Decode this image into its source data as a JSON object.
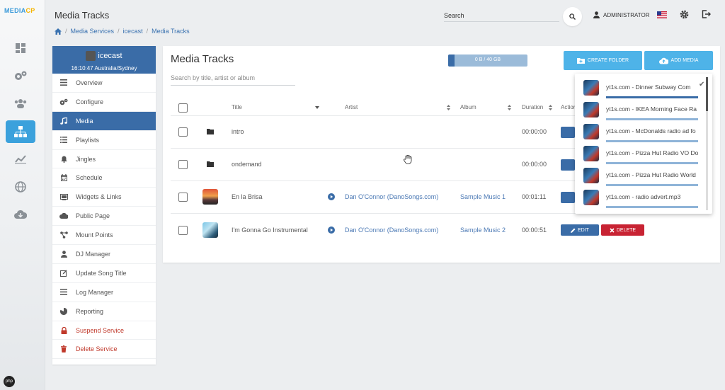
{
  "app": {
    "logo_text": "MEDIA",
    "logo_suffix": "CP",
    "php_badge": "php"
  },
  "header": {
    "title": "Media Tracks",
    "search_placeholder": "Search",
    "user_label": "ADMINISTRATOR",
    "breadcrumb": [
      "Media Services",
      "icecast",
      "Media Tracks"
    ]
  },
  "service": {
    "name": "icecast",
    "clock": "16:10:47 Australia/Sydney",
    "nav": [
      {
        "label": "Overview",
        "icon": "list-icon"
      },
      {
        "label": "Configure",
        "icon": "gears-icon"
      },
      {
        "label": "Media",
        "icon": "music-icon",
        "active": true
      },
      {
        "label": "Playlists",
        "icon": "playlist-icon"
      },
      {
        "label": "Jingles",
        "icon": "bell-icon"
      },
      {
        "label": "Schedule",
        "icon": "calendar-icon"
      },
      {
        "label": "Widgets & Links",
        "icon": "widget-icon"
      },
      {
        "label": "Public Page",
        "icon": "cloud-icon"
      },
      {
        "label": "Mount Points",
        "icon": "network-icon"
      },
      {
        "label": "DJ Manager",
        "icon": "user-icon"
      },
      {
        "label": "Update Song Title",
        "icon": "edit-icon"
      },
      {
        "label": "Log Manager",
        "icon": "log-icon"
      },
      {
        "label": "Reporting",
        "icon": "pie-icon"
      },
      {
        "label": "Suspend Service",
        "icon": "lock-icon",
        "danger": true
      },
      {
        "label": "Delete Service",
        "icon": "trash-icon",
        "danger": true
      }
    ]
  },
  "main": {
    "title": "Media Tracks",
    "search_placeholder": "Search by title, artist or album",
    "quota": {
      "text": "0 B / 40 GB",
      "fraction": 0.08
    },
    "create_folder_label": "CREATE FOLDER",
    "add_media_label": "ADD MEDIA",
    "columns": {
      "title": "Title",
      "artist": "Artist",
      "album": "Album",
      "duration": "Duration",
      "actions": "Actions"
    },
    "rows": [
      {
        "type": "folder",
        "title": "intro",
        "artist": "",
        "album": "",
        "duration": "00:00:00"
      },
      {
        "type": "folder",
        "title": "ondemand",
        "artist": "",
        "album": "",
        "duration": "00:00:00"
      },
      {
        "type": "track",
        "title": "En la Brisa",
        "artist": "Dan O'Connor (DanoSongs.com)",
        "album": "Sample Music 1",
        "duration": "00:01:11"
      },
      {
        "type": "track",
        "title": "I'm Gonna Go Instrumental",
        "artist": "Dan O'Connor (DanoSongs.com)",
        "album": "Sample Music 2",
        "duration": "00:00:51"
      }
    ],
    "edit_label": "EDIT",
    "delete_label": "DELETE"
  },
  "uploads": [
    {
      "name": "yt1s.com - Dinner Subway Com",
      "progress": 1.0,
      "done": true
    },
    {
      "name": "yt1s.com - IKEA Morning Face Ra",
      "progress": 1.0
    },
    {
      "name": "yt1s.com - McDonalds radio ad fo",
      "progress": 1.0
    },
    {
      "name": "yt1s.com - Pizza Hut Radio VO Do",
      "progress": 1.0
    },
    {
      "name": "yt1s.com - Pizza Hut Radio World",
      "progress": 1.0
    },
    {
      "name": "yt1s.com - radio advert.mp3",
      "progress": 1.0
    }
  ],
  "colors": {
    "primary": "#3a6ca7",
    "accent": "#4eb3e8",
    "danger": "#c82333"
  }
}
